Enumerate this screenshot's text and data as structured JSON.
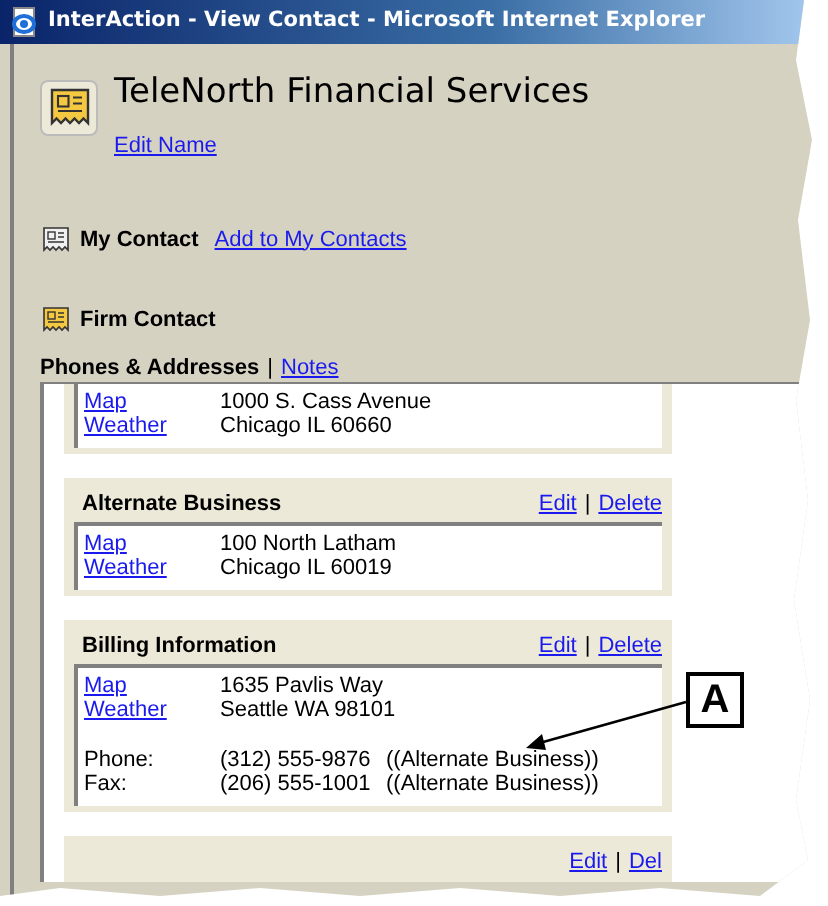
{
  "window": {
    "title": "InterAction - View Contact - Microsoft Internet Explorer"
  },
  "contact": {
    "name": "TeleNorth Financial Services",
    "edit_link": "Edit Name"
  },
  "my_contact": {
    "label": "My Contact",
    "link": "Add to My Contacts"
  },
  "firm_contact": {
    "label": "Firm Contact"
  },
  "section_tabs": [
    {
      "label": "Phones & Addresses",
      "selected": true
    },
    {
      "label": "Notes",
      "selected": false
    }
  ],
  "tab_separator": "|",
  "addresses": [
    {
      "links": [
        "Map",
        "Weather"
      ],
      "lines": [
        "1000 S. Cass Avenue",
        "Chicago IL 60660"
      ]
    },
    {
      "title": "Alternate Business",
      "actions": [
        "Edit",
        "Delete"
      ],
      "separator": "|",
      "links": [
        "Map",
        "Weather"
      ],
      "lines": [
        "100 North Latham",
        "Chicago IL 60019"
      ]
    },
    {
      "title": "Billing Information",
      "actions": [
        "Edit",
        "Delete"
      ],
      "separator": "|",
      "links": [
        "Map",
        "Weather"
      ],
      "lines": [
        "1635 Pavlis Way",
        "Seattle WA 98101"
      ],
      "phones": [
        {
          "label": "Phone:",
          "number": "(312) 555-9876",
          "note": "((Alternate Business))"
        },
        {
          "label": "Fax:",
          "number": "(206) 555-1001",
          "note": "((Alternate Business))"
        }
      ]
    },
    {
      "actions": [
        "Edit",
        "Del"
      ],
      "separator": "|"
    }
  ],
  "callout": {
    "label": "A"
  }
}
